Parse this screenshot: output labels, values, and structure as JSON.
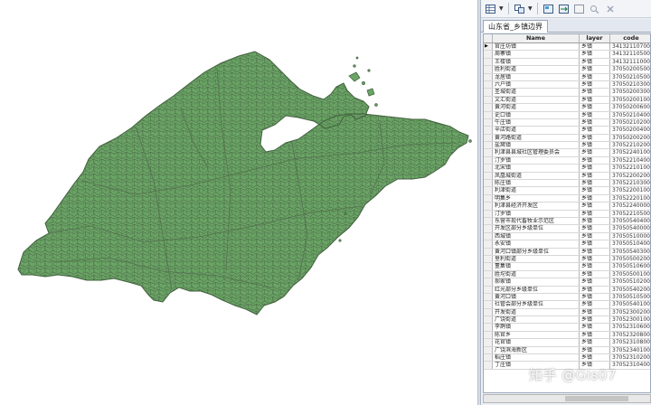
{
  "toolbar": {
    "icons": [
      "table-options-icon",
      "related-tables-icon",
      "select-by-attributes-icon",
      "switch-selection-icon",
      "clear-selection-icon",
      "zoom-to-selected-icon",
      "delete-selected-icon"
    ]
  },
  "tab": {
    "label": "山东省_乡镇边界"
  },
  "table": {
    "columns": [
      "Name",
      "layer",
      "code"
    ],
    "rows": [
      {
        "name": "官庄坊镇",
        "layer": "乡镇",
        "code": "341321107000"
      },
      {
        "name": "周寨镇",
        "layer": "乡镇",
        "code": "341321105000"
      },
      {
        "name": "王楼镇",
        "layer": "乡镇",
        "code": "341321110000"
      },
      {
        "name": "胜利街道",
        "layer": "乡镇",
        "code": "370502005000"
      },
      {
        "name": "龙居镇",
        "layer": "乡镇",
        "code": "370502105000"
      },
      {
        "name": "六户镇",
        "layer": "乡镇",
        "code": "370502103000"
      },
      {
        "name": "圣城街道",
        "layer": "乡镇",
        "code": "370502003000"
      },
      {
        "name": "文汇街道",
        "layer": "乡镇",
        "code": "370502001000"
      },
      {
        "name": "黄河街道",
        "layer": "乡镇",
        "code": "370502006000"
      },
      {
        "name": "史口镇",
        "layer": "乡镇",
        "code": "370502104000"
      },
      {
        "name": "牛庄镇",
        "layer": "乡镇",
        "code": "370502102000"
      },
      {
        "name": "辛店街道",
        "layer": "乡镇",
        "code": "370502004000"
      },
      {
        "name": "黄河路街道",
        "layer": "乡镇",
        "code": "370502002000"
      },
      {
        "name": "盐窝镇",
        "layer": "乡镇",
        "code": "370522102000"
      },
      {
        "name": "利津县县城社区管理委员会",
        "layer": "乡镇",
        "code": "370522401000"
      },
      {
        "name": "汀罗镇",
        "layer": "乡镇",
        "code": "370522104000"
      },
      {
        "name": "北宋镇",
        "layer": "乡镇",
        "code": "370522101000"
      },
      {
        "name": "凤凰城街道",
        "layer": "乡镇",
        "code": "370522002000"
      },
      {
        "name": "陈庄镇",
        "layer": "乡镇",
        "code": "370522103000"
      },
      {
        "name": "利津街道",
        "layer": "乡镇",
        "code": "370522001000"
      },
      {
        "name": "明集乡",
        "layer": "乡镇",
        "code": "370522201000"
      },
      {
        "name": "利津县经济开发区",
        "layer": "乡镇",
        "code": "370522400000"
      },
      {
        "name": "汀罗镇",
        "layer": "乡镇",
        "code": "370522105000"
      },
      {
        "name": "东营市现代畜牧业示范区",
        "layer": "乡镇",
        "code": "370505404000"
      },
      {
        "name": "开发区部分乡级单位",
        "layer": "乡镇",
        "code": "370505400000"
      },
      {
        "name": "西城镇",
        "layer": "乡镇",
        "code": "370505100000"
      },
      {
        "name": "永安镇",
        "layer": "乡镇",
        "code": "370505104000"
      },
      {
        "name": "黄河口镇部分乡级单位",
        "layer": "乡镇",
        "code": "370505403000"
      },
      {
        "name": "垦利街道",
        "layer": "乡镇",
        "code": "370505002000"
      },
      {
        "name": "董集镇",
        "layer": "乡镇",
        "code": "370505106000"
      },
      {
        "name": "胜坨街道",
        "layer": "乡镇",
        "code": "370505001000"
      },
      {
        "name": "郝家镇",
        "layer": "乡镇",
        "code": "370505102000"
      },
      {
        "name": "红光部分乡级单位",
        "layer": "乡镇",
        "code": "370505402000"
      },
      {
        "name": "黄河口镇",
        "layer": "乡镇",
        "code": "370505105000"
      },
      {
        "name": "社管会部分乡级单位",
        "layer": "乡镇",
        "code": "370505401000"
      },
      {
        "name": "开发街道",
        "layer": "乡镇",
        "code": "370523002000"
      },
      {
        "name": "广饶街道",
        "layer": "乡镇",
        "code": "370523001000"
      },
      {
        "name": "李鹊镇",
        "layer": "乡镇",
        "code": "370523106000"
      },
      {
        "name": "陈官乡",
        "layer": "乡镇",
        "code": "370523208000"
      },
      {
        "name": "花官镇",
        "layer": "乡镇",
        "code": "370523108000"
      },
      {
        "name": "广饶滨海新区",
        "layer": "乡镇",
        "code": "370523401000"
      },
      {
        "name": "稻庄镇",
        "layer": "乡镇",
        "code": "370523102000"
      },
      {
        "name": "丁庄镇",
        "layer": "乡镇",
        "code": "370523104000"
      }
    ],
    "selected_row": 0
  },
  "map": {
    "fill": "#6aa565",
    "stroke": "#3f5f3c",
    "background": "#ffffff"
  },
  "watermark": {
    "text": "知乎 @Gis07"
  },
  "colors": {
    "panel_bg": "#eef1f6",
    "header_bg": "#f0f0f0"
  }
}
